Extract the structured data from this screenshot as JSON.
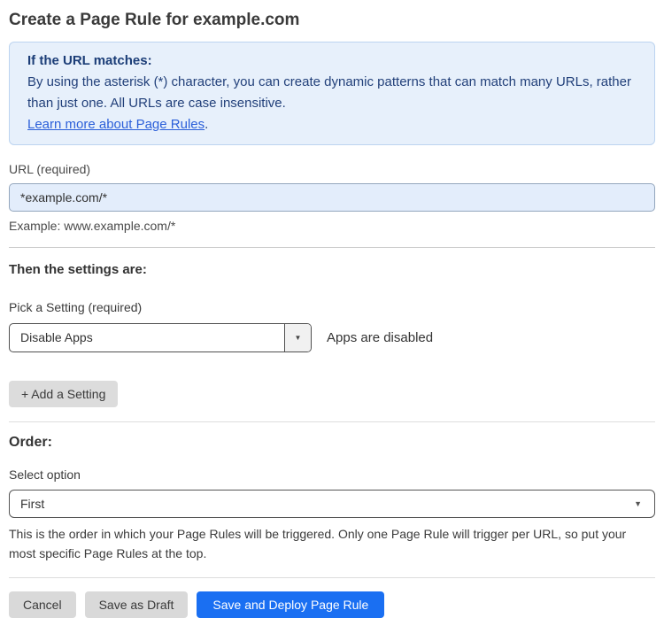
{
  "page": {
    "title": "Create a Page Rule for example.com"
  },
  "info_box": {
    "heading": "If the URL matches:",
    "body": "By using the asterisk (*) character, you can create dynamic patterns that can match many URLs, rather than just one. All URLs are case insensitive.",
    "link_label": "Learn more about Page Rules",
    "link_suffix": "."
  },
  "url_field": {
    "label": "URL (required)",
    "value": "*example.com/*",
    "example": "Example: www.example.com/*"
  },
  "settings_section": {
    "heading": "Then the settings are:",
    "picker_label": "Pick a Setting (required)",
    "selected_setting": "Disable Apps",
    "status_text": "Apps are disabled",
    "add_setting_label": "+ Add a Setting"
  },
  "order_section": {
    "heading": "Order:",
    "select_label": "Select option",
    "selected_option": "First",
    "help_text": "This is the order in which your Page Rules will be triggered. Only one Page Rule will trigger per URL, so put your most specific Page Rules at the top."
  },
  "footer": {
    "cancel_label": "Cancel",
    "save_draft_label": "Save as Draft",
    "deploy_label": "Save and Deploy Page Rule"
  },
  "icons": {
    "dropdown_caret": "▼"
  },
  "colors": {
    "info_box_bg": "#e7f0fb",
    "info_box_border": "#bcd4f0",
    "info_text": "#22407a",
    "link_blue": "#2b5fd9",
    "input_bg": "#e3edfb",
    "primary_button_bg": "#1a6ff2",
    "gray_button_bg": "#d9d9d9"
  }
}
